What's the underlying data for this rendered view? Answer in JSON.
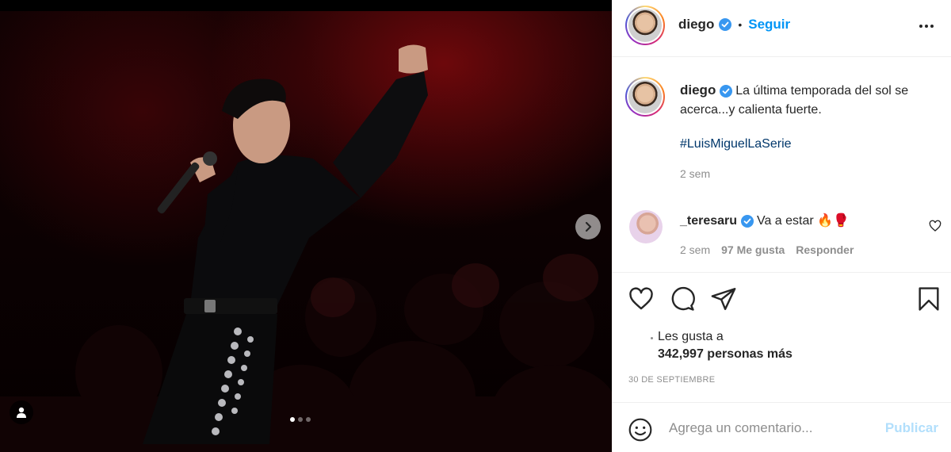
{
  "post_header": {
    "username": "diego",
    "separator": "•",
    "follow_label": "Seguir"
  },
  "caption": {
    "username": "diego",
    "text": "La última temporada del sol se acerca...y calienta fuerte.",
    "hashtag": "#LuisMiguelLaSerie",
    "time": "2 sem"
  },
  "comments": [
    {
      "username": "_teresaru",
      "text": "Va a estar 🔥🥊",
      "time": "2 sem",
      "likes": "97 Me gusta",
      "reply_label": "Responder"
    }
  ],
  "likes": {
    "line1": "Les gusta a",
    "count": "342,997",
    "suffix": "personas más"
  },
  "date": "30 DE SEPTIEMBRE",
  "comment_form": {
    "placeholder": "Agrega un comentario...",
    "publish_label": "Publicar"
  },
  "carousel": {
    "total_slides": 3,
    "active_slide": 1
  },
  "icons": {
    "verified": "verified-badge-icon",
    "more": "more-options-icon",
    "like": "heart-icon",
    "comment": "comment-icon",
    "share": "paper-plane-icon",
    "save": "bookmark-icon",
    "emoji": "smiley-icon",
    "next": "chevron-right-icon",
    "tag": "user-tag-icon"
  },
  "colors": {
    "accent": "#0095f6",
    "hashtag": "#00376b",
    "muted": "#8e8e8e",
    "publish_disabled": "#b2dffc"
  }
}
